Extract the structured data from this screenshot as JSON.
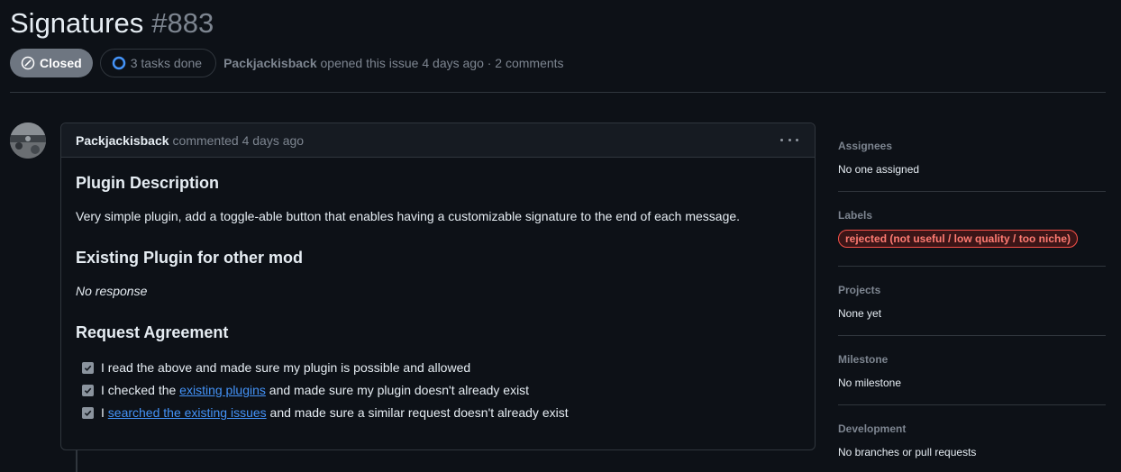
{
  "issue": {
    "title": "Signatures",
    "number": "#883",
    "state": "Closed",
    "tasks": "3 tasks done",
    "author": "Packjackisback",
    "opened_text": "opened this issue 4 days ago · 2 comments"
  },
  "comment": {
    "author": "Packjackisback",
    "time_text": "commented 4 days ago",
    "sections": [
      {
        "heading": "Plugin Description",
        "text": "Very simple plugin, add a toggle-able button that enables having a customizable signature to the end of each message."
      },
      {
        "heading": "Existing Plugin for other mod",
        "text": "No response"
      },
      {
        "heading": "Request Agreement"
      }
    ],
    "tasks": [
      {
        "pre": "I read the above and made sure my plugin is possible and allowed",
        "link": "",
        "post": ""
      },
      {
        "pre": "I checked the ",
        "link": "existing plugins",
        "post": " and made sure my plugin doesn't already exist"
      },
      {
        "pre": "I ",
        "link": "searched the existing issues",
        "post": " and made sure a similar request doesn't already exist"
      }
    ]
  },
  "sidebar": {
    "assignees": {
      "label": "Assignees",
      "value": "No one assigned"
    },
    "labels": {
      "label": "Labels",
      "value": "rejected (not useful / low quality / too niche)"
    },
    "projects": {
      "label": "Projects",
      "value": "None yet"
    },
    "milestone": {
      "label": "Milestone",
      "value": "No milestone"
    },
    "development": {
      "label": "Development",
      "value": "No branches or pull requests"
    }
  },
  "colors": {
    "closed": "#6e7681",
    "link": "#4493f8",
    "label_border": "#f85149",
    "label_text": "#ff7b72"
  },
  "icons": [
    "skip-icon",
    "progress-circle-icon",
    "kebab-icon",
    "checkbox-checked-icon"
  ]
}
